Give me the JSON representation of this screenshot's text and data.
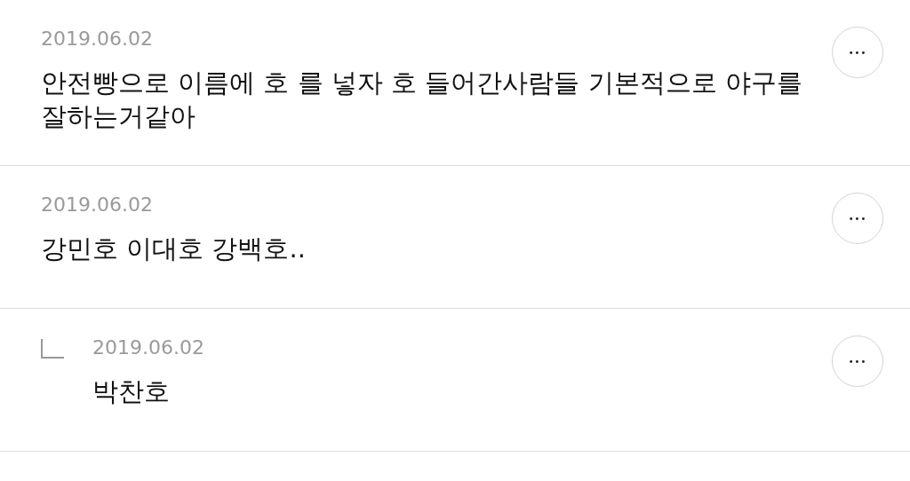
{
  "comments": [
    {
      "date": "2019.06.02",
      "text": "안전빵으로 이름에 호 를 넣자 호 들어간사람들 기본적으로 야구를 잘하는거같아",
      "more": "•••"
    },
    {
      "date": "2019.06.02",
      "text": "강민호 이대호 강백호..",
      "more": "•••",
      "children": [
        {
          "date": "2019.06.02",
          "text": "박찬호",
          "more": "•••"
        }
      ]
    }
  ]
}
